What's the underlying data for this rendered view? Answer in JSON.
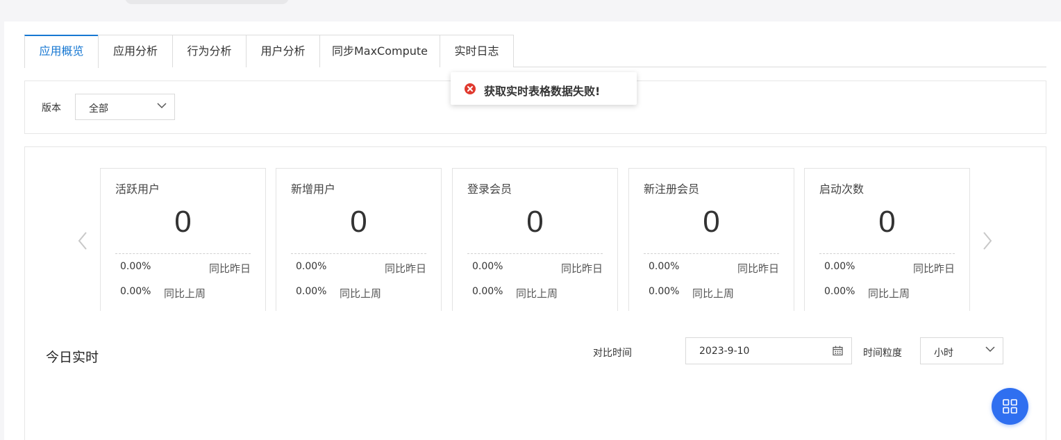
{
  "tabs": [
    {
      "label": "应用概览",
      "active": true
    },
    {
      "label": "应用分析"
    },
    {
      "label": "行为分析"
    },
    {
      "label": "用户分析"
    },
    {
      "label": "同步MaxCompute"
    },
    {
      "label": "实时日志"
    }
  ],
  "filter": {
    "version_label": "版本",
    "version_value": "全部"
  },
  "toast": {
    "message": "获取实时表格数据失败!",
    "type": "error",
    "color": "#e03a2f"
  },
  "cards": [
    {
      "title": "活跃用户",
      "value": "0",
      "yoy_pct": "0.00%",
      "yoy_label": "同比昨日",
      "wow_pct": "0.00%",
      "wow_label": "同比上周"
    },
    {
      "title": "新增用户",
      "value": "0",
      "yoy_pct": "0.00%",
      "yoy_label": "同比昨日",
      "wow_pct": "0.00%",
      "wow_label": "同比上周"
    },
    {
      "title": "登录会员",
      "value": "0",
      "yoy_pct": "0.00%",
      "yoy_label": "同比昨日",
      "wow_pct": "0.00%",
      "wow_label": "同比上周"
    },
    {
      "title": "新注册会员",
      "value": "0",
      "yoy_pct": "0.00%",
      "yoy_label": "同比昨日",
      "wow_pct": "0.00%",
      "wow_label": "同比上周"
    },
    {
      "title": "启动次数",
      "value": "0",
      "yoy_pct": "0.00%",
      "yoy_label": "同比昨日",
      "wow_pct": "0.00%",
      "wow_label": "同比上周"
    }
  ],
  "realtime": {
    "title": "今日实时",
    "compare_label": "对比时间",
    "compare_date": "2023-9-10",
    "granularity_label": "时间粒度",
    "granularity_value": "小时"
  },
  "icons": {
    "prev": "chevron-left-icon",
    "next": "chevron-right-icon",
    "dropdown": "chevron-down-icon",
    "calendar": "calendar-icon",
    "error": "error-circle-icon",
    "fab": "grid-icon"
  },
  "colors": {
    "accent": "#1677d2",
    "fab": "#2f6ff0",
    "error": "#e03a2f"
  }
}
